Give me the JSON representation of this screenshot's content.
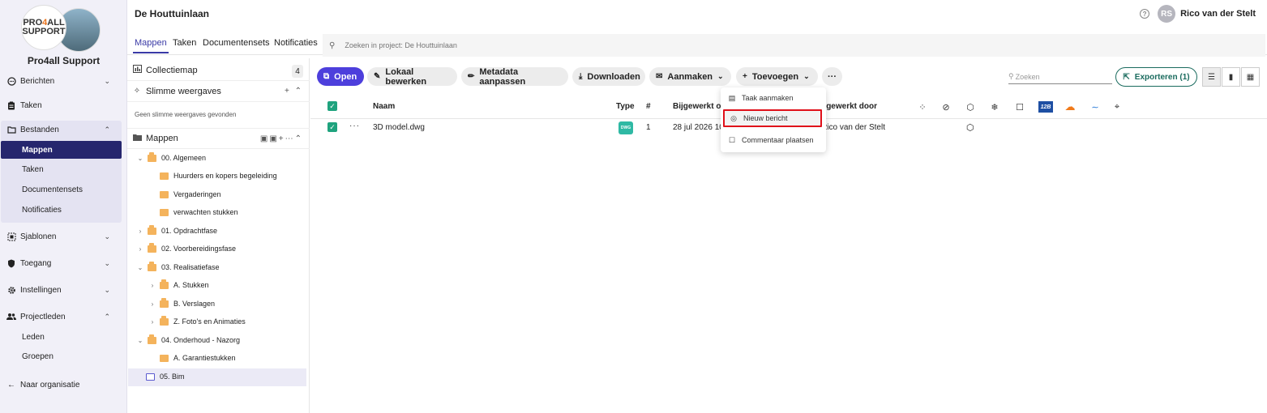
{
  "org": {
    "logo_line1a": "PRO",
    "logo_line1b": "4",
    "logo_line1c": "ALL",
    "logo_line2": "SUPPORT",
    "name": "Pro4all Support"
  },
  "nav": {
    "berichten": "Berichten",
    "taken": "Taken",
    "bestanden": "Bestanden",
    "bestanden_sub": [
      "Mappen",
      "Taken",
      "Documentensets",
      "Notificaties"
    ],
    "sjablonen": "Sjablonen",
    "toegang": "Toegang",
    "instellingen": "Instellingen",
    "projectleden": "Projectleden",
    "projectleden_sub": [
      "Leden",
      "Groepen"
    ],
    "naar_organisatie": "Naar organisatie"
  },
  "header": {
    "project_title": "De Houttuinlaan",
    "user_initials": "RS",
    "user_name": "Rico van der Stelt"
  },
  "tabs": [
    "Mappen",
    "Taken",
    "Documentensets",
    "Notificaties"
  ],
  "search": {
    "placeholder": "Zoeken in project: De Houttuinlaan"
  },
  "panel": {
    "collection": "Collectiemap",
    "collection_count": "4",
    "smart_views": "Slimme weergaves",
    "smart_views_empty": "Geen slimme weergaves gevonden",
    "folders": "Mappen",
    "tree": [
      "00. Algemeen",
      "Huurders en kopers begeleiding",
      "Vergaderingen",
      "verwachten stukken",
      "01. Opdrachtfase",
      "02. Voorbereidingsfase",
      "03. Realisatiefase",
      "A. Stukken",
      "B. Verslagen",
      "Z. Foto's en Animaties",
      "04. Onderhoud - Nazorg",
      "A. Garantiestukken",
      "05. Bim"
    ]
  },
  "toolbar": {
    "open": "Open",
    "local_edit": "Lokaal bewerken",
    "metadata": "Metadata aanpassen",
    "download": "Downloaden",
    "create": "Aanmaken",
    "add": "Toevoegen",
    "more": "···",
    "search_placeholder": "Zoeken",
    "export": "Exporteren (1)"
  },
  "table": {
    "headers": {
      "name": "Naam",
      "type": "Type",
      "number": "#",
      "updated_on": "Bijgewerkt op",
      "updated_by": "Bijgewerkt door"
    },
    "rows": [
      {
        "name": "3D model.dwg",
        "type": "DWG",
        "version": "1",
        "updated_on": "28 jul 2026 10:",
        "updated_by": "Rico van der Stelt"
      }
    ],
    "icon_badge": "12B",
    "icon_badge_color": "#1e4fa3",
    "icon_orange_color": "#f07a1a"
  },
  "dropdown": {
    "items": [
      "Taak aanmaken",
      "Nieuw bericht",
      "Commentaar plaatsen"
    ],
    "highlight_color": "#e0101a"
  },
  "colors": {
    "primary": "#4d3fdc",
    "nav_active": "#26266e",
    "accent_green": "#1fa37e"
  }
}
